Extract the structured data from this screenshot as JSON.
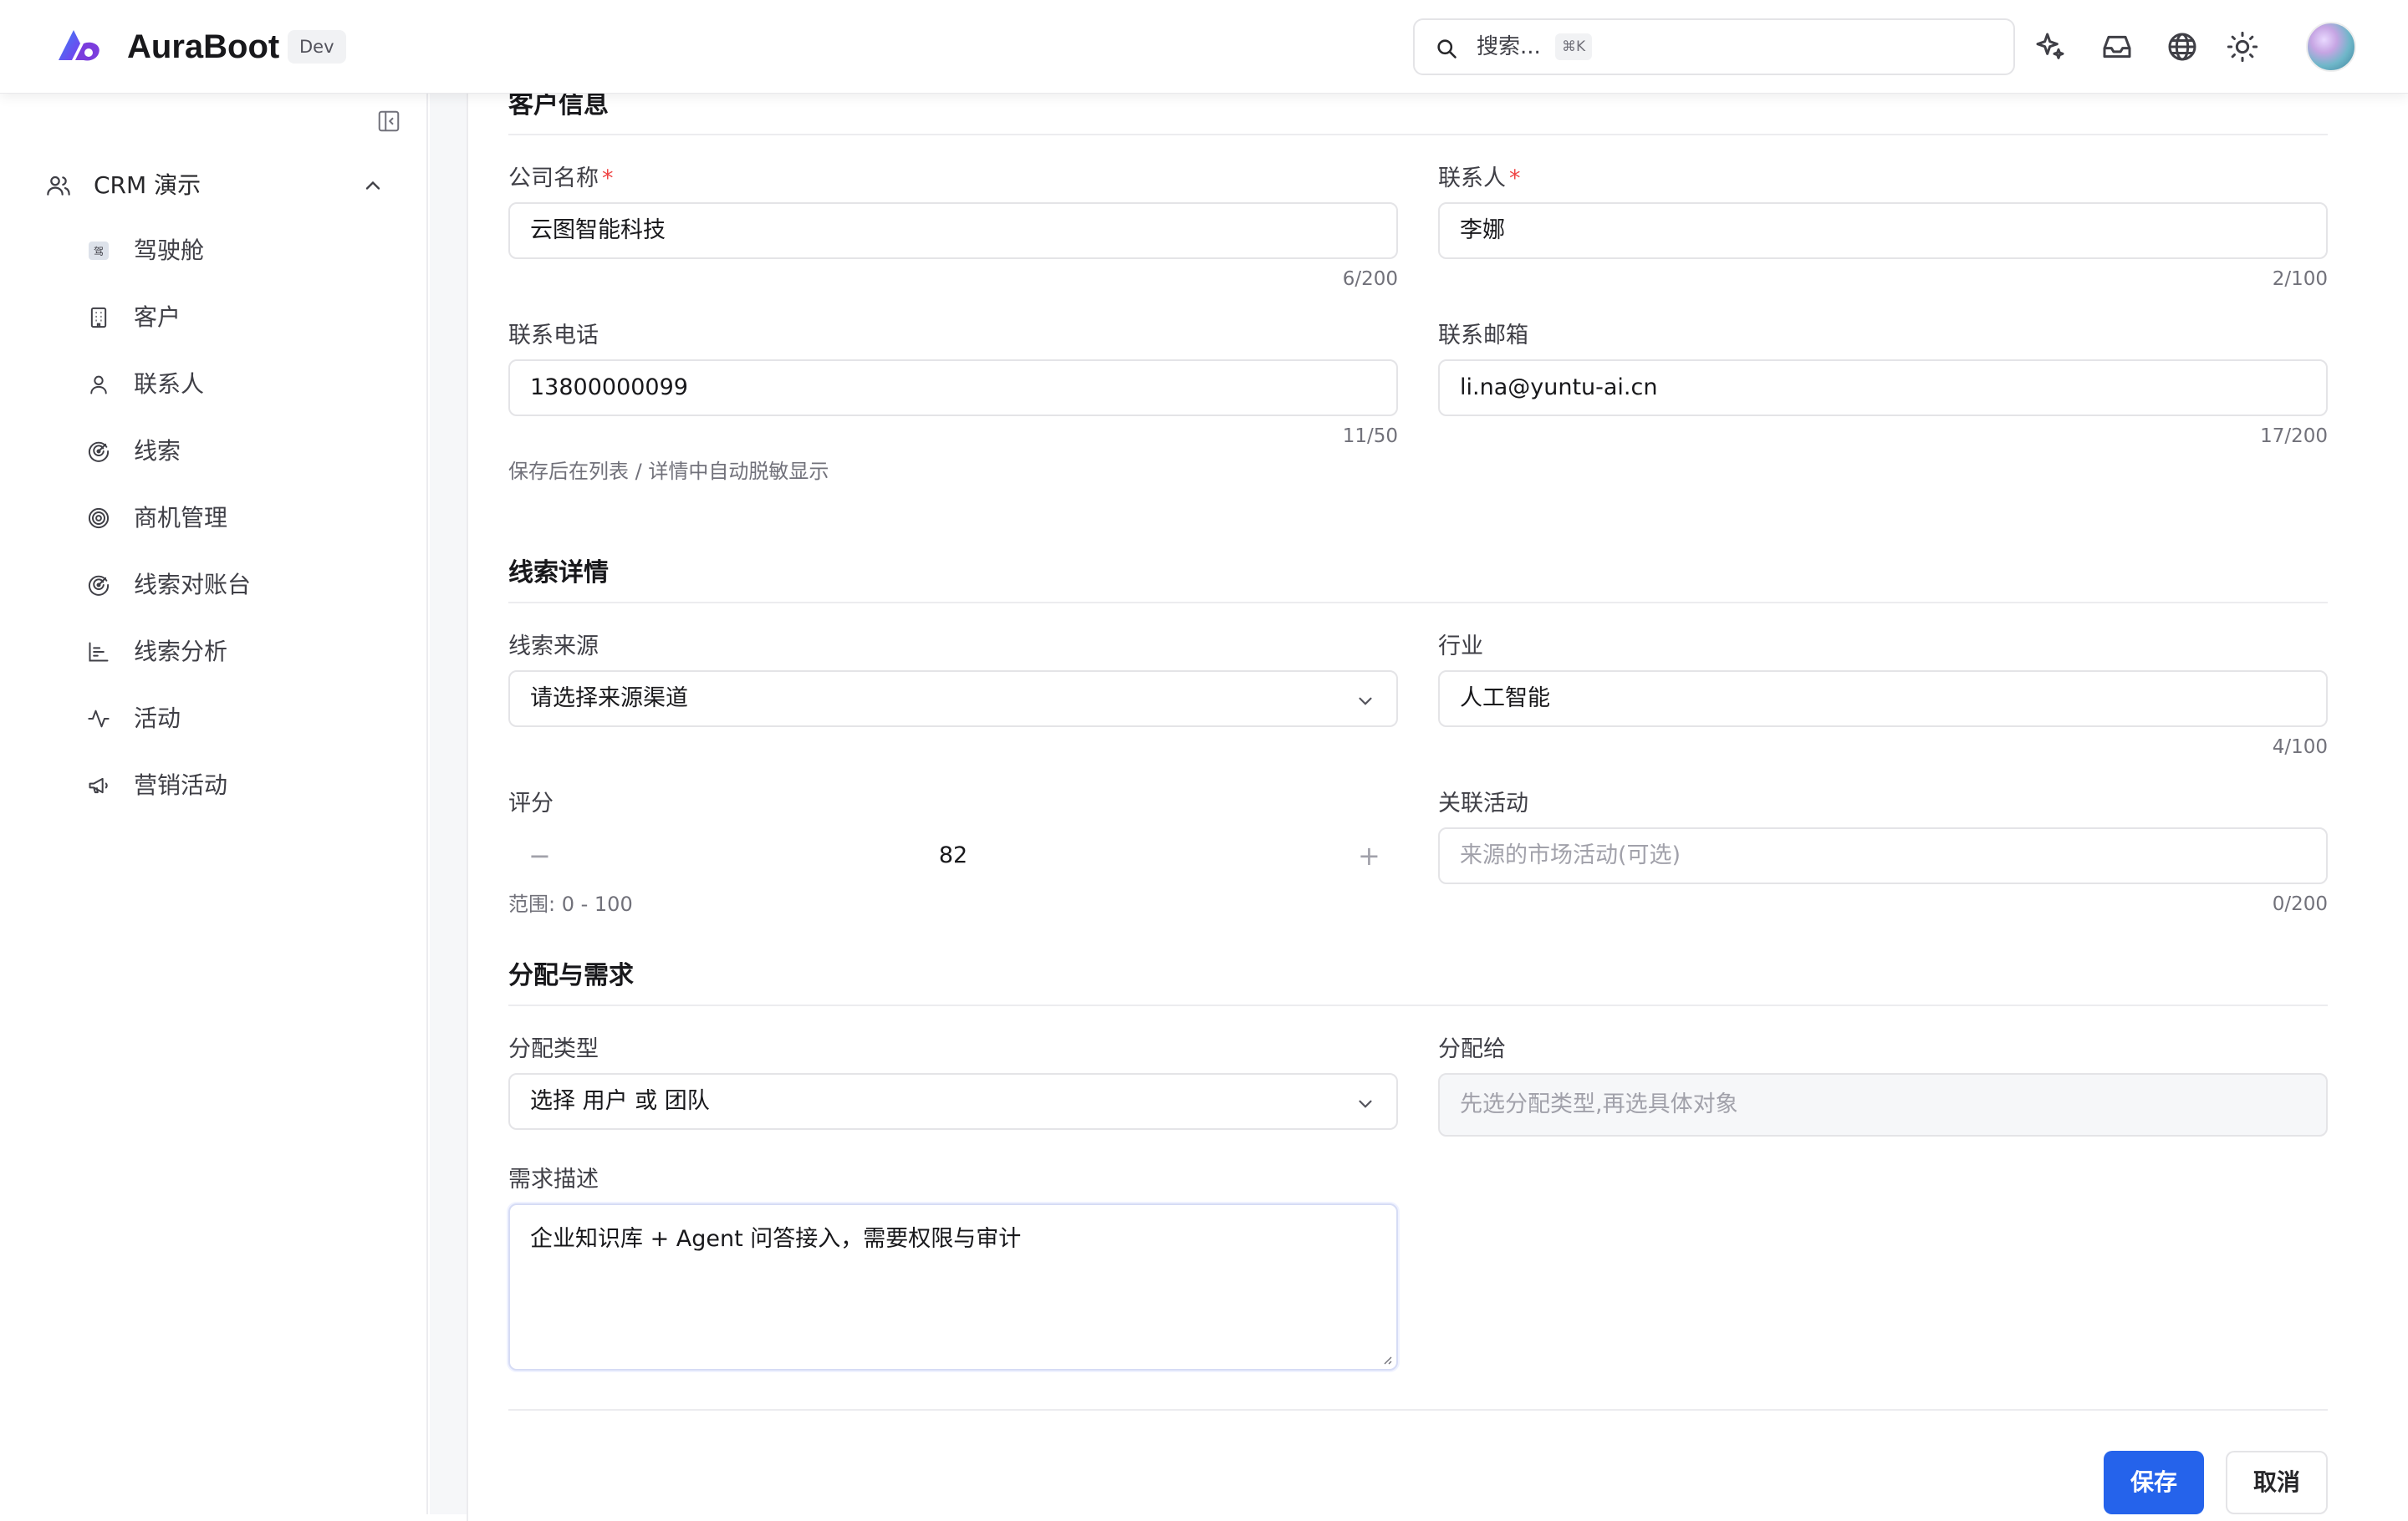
{
  "app": {
    "title": "AuraBoot",
    "badge": "Dev"
  },
  "header": {
    "search_placeholder": "搜索...",
    "search_shortcut": "⌘K"
  },
  "sidebar": {
    "group_label": "CRM 演示",
    "items": [
      {
        "label": "驾驶舱",
        "icon": "cockpit-icon"
      },
      {
        "label": "客户",
        "icon": "building-icon"
      },
      {
        "label": "联系人",
        "icon": "user-icon"
      },
      {
        "label": "线索",
        "icon": "radar-icon"
      },
      {
        "label": "商机管理",
        "icon": "target-icon"
      },
      {
        "label": "线索对账台",
        "icon": "radar-icon"
      },
      {
        "label": "线索分析",
        "icon": "bar-chart-icon"
      },
      {
        "label": "活动",
        "icon": "activity-icon"
      },
      {
        "label": "营销活动",
        "icon": "megaphone-icon"
      }
    ]
  },
  "form": {
    "section_customer": "客户信息",
    "company": {
      "label": "公司名称",
      "value": "云图智能科技",
      "counter": "6/200"
    },
    "contact": {
      "label": "联系人",
      "value": "李娜",
      "counter": "2/100"
    },
    "phone": {
      "label": "联系电话",
      "value": "13800000099",
      "counter": "11/50",
      "hint": "保存后在列表 / 详情中自动脱敏显示"
    },
    "email": {
      "label": "联系邮箱",
      "value": "li.na@yuntu-ai.cn",
      "counter": "17/200"
    },
    "section_lead": "线索详情",
    "source": {
      "label": "线索来源",
      "placeholder": "请选择来源渠道"
    },
    "industry": {
      "label": "行业",
      "value": "人工智能",
      "counter": "4/100"
    },
    "score": {
      "label": "评分",
      "value": "82",
      "minus": "−",
      "plus": "+",
      "hint": "范围: 0 - 100"
    },
    "campaign": {
      "label": "关联活动",
      "placeholder": "来源的市场活动(可选)",
      "counter": "0/200"
    },
    "section_assign": "分配与需求",
    "assign_type": {
      "label": "分配类型",
      "value": "选择 用户 或 团队"
    },
    "assign_to": {
      "label": "分配给",
      "placeholder": "先选分配类型,再选具体对象"
    },
    "requirement": {
      "label": "需求描述",
      "value": "企业知识库 + Agent 问答接入，需要权限与审计"
    },
    "required_mark": "*"
  },
  "actions": {
    "save": "保存",
    "cancel": "取消"
  },
  "colors": {
    "primary": "#2563eb",
    "required": "#ef4444"
  }
}
